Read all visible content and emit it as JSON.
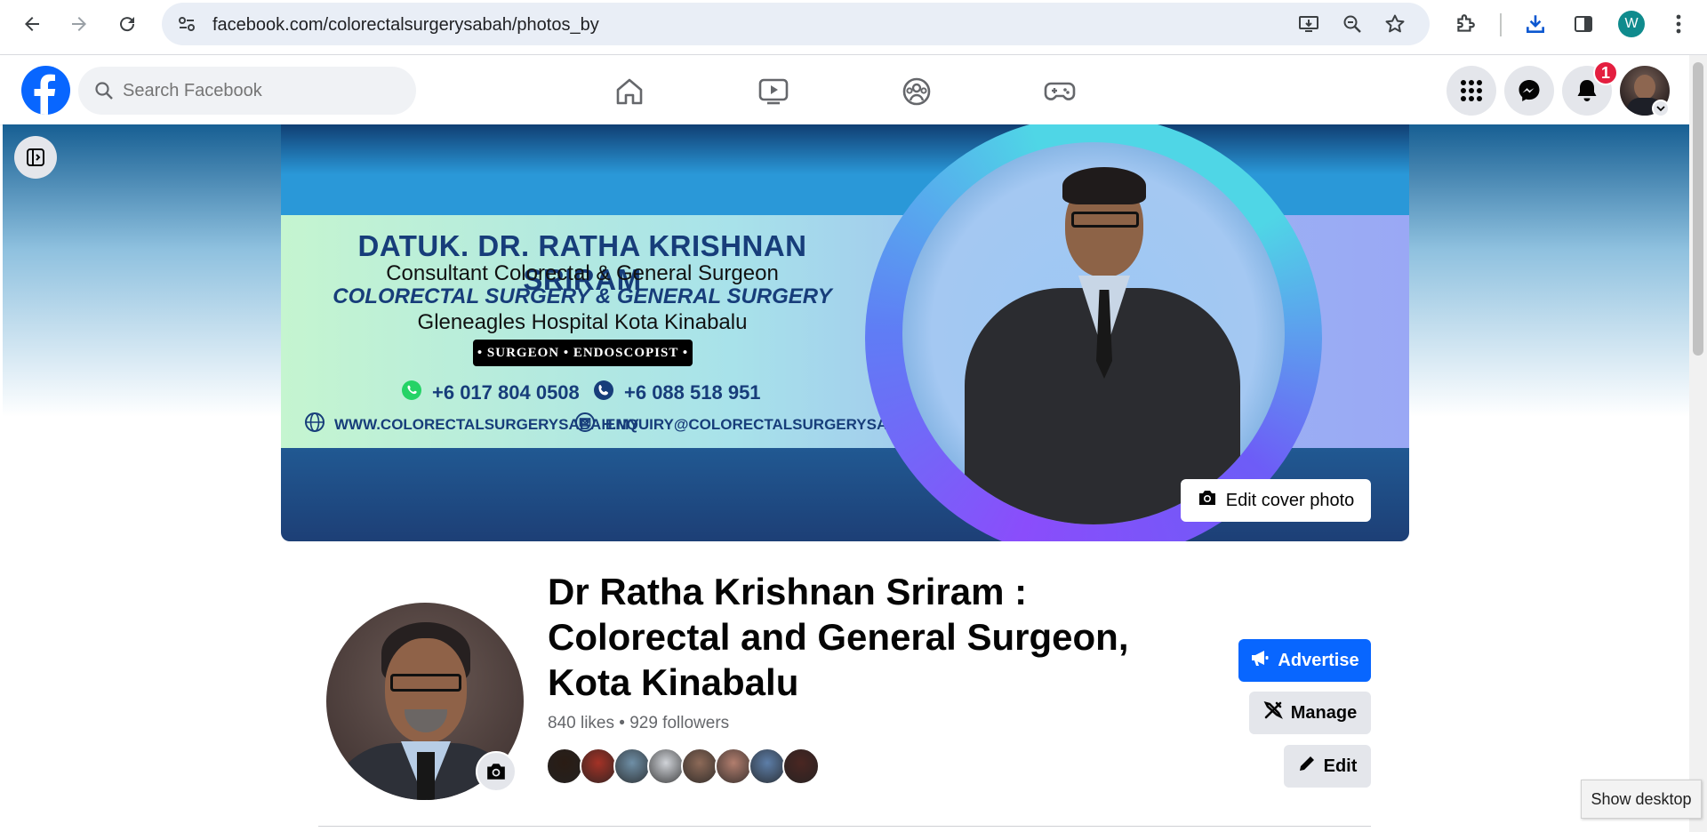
{
  "browser": {
    "url": "facebook.com/colorectalsurgerysabah/photos_by",
    "profile_initial": "W"
  },
  "facebook": {
    "search_placeholder": "Search Facebook",
    "notification_count": "1"
  },
  "cover": {
    "name": "DATUK. DR. RATHA KRISHNAN SRIRAM",
    "title": "Consultant Colorectal & General Surgeon",
    "specialty": "COLORECTAL SURGERY & GENERAL SURGERY",
    "hospital": "Gleneagles Hospital Kota Kinabalu",
    "tagline": "• SURGEON • ENDOSCOPIST •",
    "whatsapp": "+6 017 804 0508",
    "phone": "+6 088 518 951",
    "website": "WWW.COLORECTALSURGERYSABAH.MY",
    "email": "ENQUIRY@COLORECTALSURGERYSABAH.MY",
    "edit_label": "Edit cover photo"
  },
  "page": {
    "title_line1": "Dr Ratha Krishnan Sriram :",
    "title_line2": "Colorectal and General Surgeon,",
    "title_line3": "Kota Kinabalu",
    "stats": "840 likes • 929 followers",
    "follower_faces": [
      "#2a1c14",
      "#a43226",
      "#6f8fa6",
      "#d0d3d8",
      "#8d6a58",
      "#b27e6e",
      "#5d7ea8",
      "#4a2622"
    ]
  },
  "actions": {
    "advertise": "Advertise",
    "manage": "Manage",
    "edit": "Edit"
  },
  "tooltip": "Show desktop",
  "colors": {
    "fb_blue": "#0866ff",
    "badge_red": "#e41e3f"
  }
}
